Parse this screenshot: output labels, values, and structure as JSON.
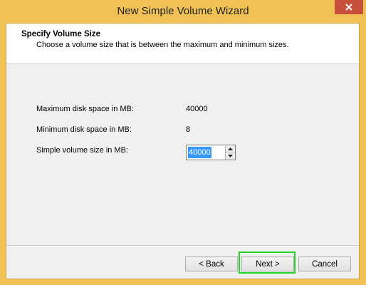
{
  "window": {
    "title": "New Simple Volume Wizard",
    "title_bar_color": "#f0c154",
    "close_button_color": "#c7503c"
  },
  "header": {
    "title": "Specify Volume Size",
    "description": "Choose a volume size that is between the maximum and minimum sizes."
  },
  "fields": {
    "max_label": "Maximum disk space in MB:",
    "max_value": "40000",
    "min_label": "Minimum disk space in MB:",
    "min_value": "8",
    "size_label": "Simple volume size in MB:",
    "size_value": "40000"
  },
  "buttons": {
    "back": "< Back",
    "next": "Next >",
    "cancel": "Cancel"
  },
  "icons": {
    "close": "close-icon",
    "spin_up": "arrow-up-icon",
    "spin_down": "arrow-down-icon"
  }
}
